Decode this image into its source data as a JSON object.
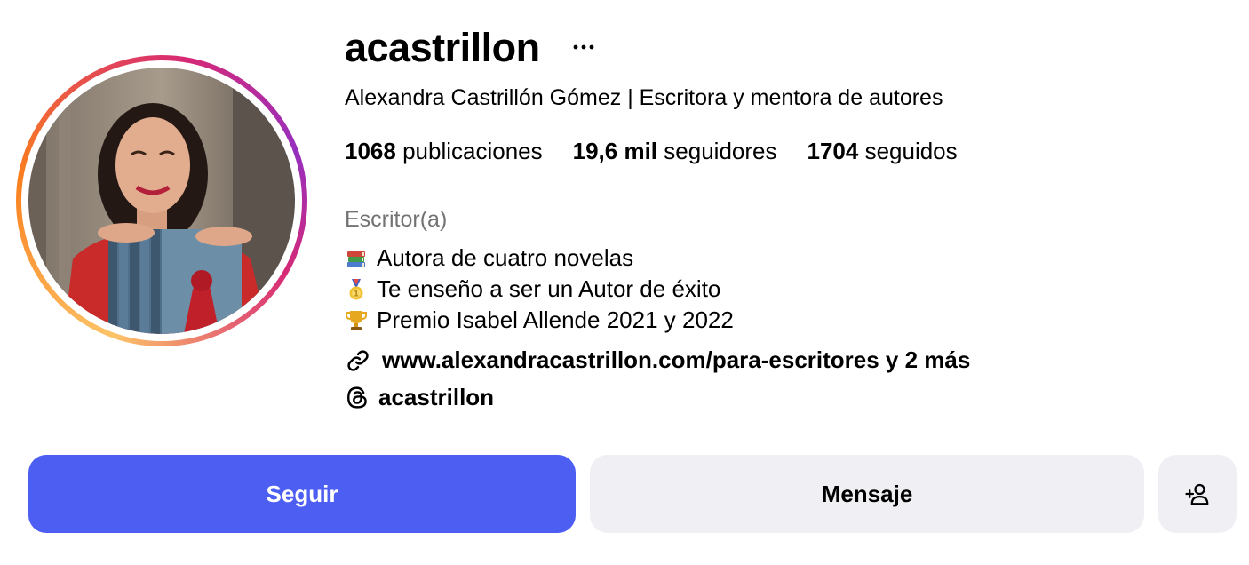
{
  "profile": {
    "username": "acastrillon",
    "full_name": "Alexandra Castrillón Gómez | Escritora y mentora de autores",
    "category": "Escritor(a)"
  },
  "stats": {
    "posts_count": "1068",
    "posts_label": "publicaciones",
    "followers_count": "19,6 mil",
    "followers_label": "seguidores",
    "following_count": "1704",
    "following_label": "seguidos"
  },
  "bio": {
    "lines": [
      {
        "icon": "books-emoji",
        "text": "Autora de cuatro novelas"
      },
      {
        "icon": "medal-emoji",
        "text": "Te enseño a ser un Autor de éxito"
      },
      {
        "icon": "trophy-emoji",
        "text": "Premio Isabel Allende 2021 y 2022"
      }
    ]
  },
  "link": {
    "icon": "link-icon",
    "text": "www.alexandracastrillon.com/para-escritores y 2 más"
  },
  "threads": {
    "icon": "threads-icon",
    "handle": "acastrillon"
  },
  "actions": {
    "follow_label": "Seguir",
    "message_label": "Mensaje",
    "suggest_icon": "add-person-icon"
  },
  "colors": {
    "follow_button": "#4d5ef2",
    "secondary_button": "#efeff4",
    "category_text": "#737373"
  }
}
